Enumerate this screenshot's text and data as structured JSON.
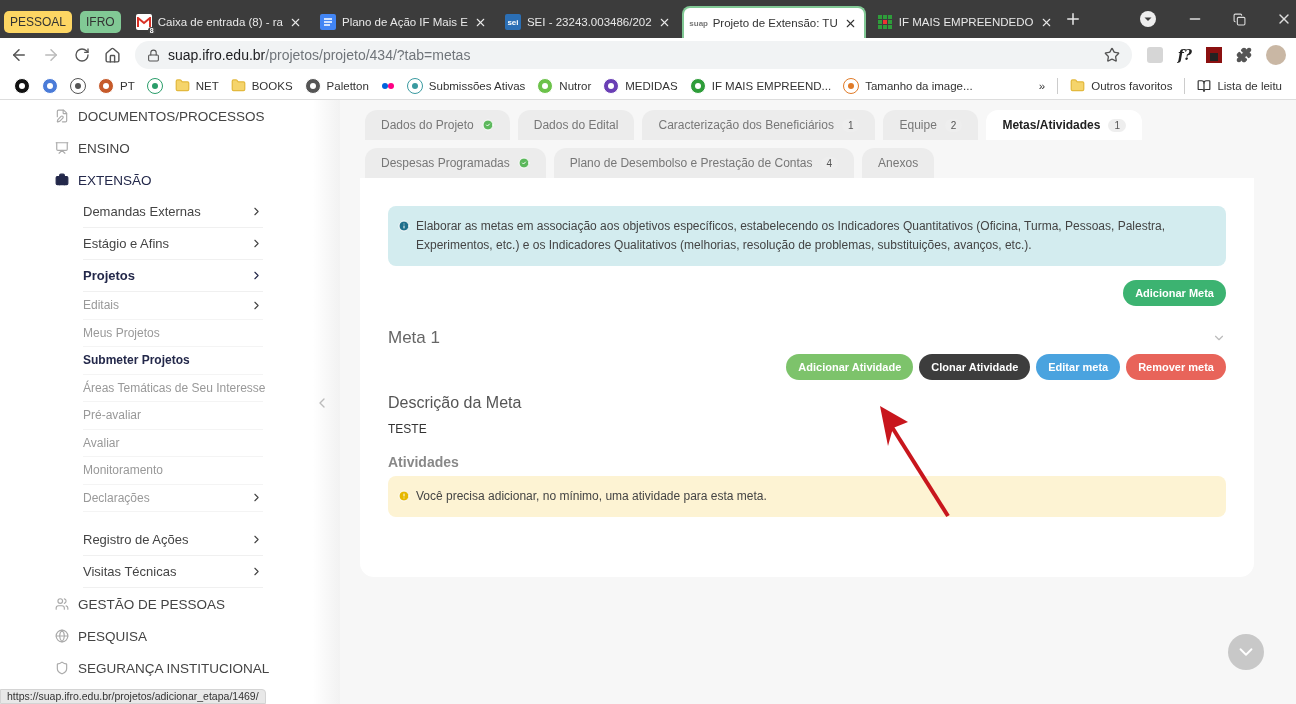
{
  "browser": {
    "groups": [
      {
        "label": "PESSOAL",
        "color": "#fdd663"
      },
      {
        "label": "IFRO",
        "color": "#81c995"
      }
    ],
    "tabs": [
      {
        "kind": "mail",
        "badge": "8",
        "title": "Caixa de entrada (8) - ra",
        "selected": false
      },
      {
        "kind": "doc",
        "title": "Plano de Ação IF Mais E",
        "selected": false
      },
      {
        "kind": "sei",
        "favicon": "sei",
        "title": "SEI - 23243.003486/202",
        "selected": false
      },
      {
        "kind": "suap",
        "favicon": "suap",
        "title": "Projeto de Extensão: TU",
        "selected": true
      },
      {
        "kind": "grid",
        "title": "IF MAIS EMPREENDEDO",
        "selected": false
      }
    ],
    "address": {
      "host": "suap.ifro.edu.br",
      "path": "/projetos/projeto/434/?tab=metas"
    },
    "extension_label": "f?",
    "bookmarks": [
      {
        "kind": "app"
      },
      {
        "kind": "circle"
      },
      {
        "kind": "clock"
      },
      {
        "kind": "ball",
        "label": "PT"
      },
      {
        "kind": "ring"
      },
      {
        "kind": "folder",
        "label": "NET"
      },
      {
        "kind": "folder",
        "label": "BOOKS"
      },
      {
        "kind": "pin",
        "label": "Paletton"
      },
      {
        "kind": "dots"
      },
      {
        "kind": "star",
        "label": "Submissões Ativas"
      },
      {
        "kind": "leaf",
        "label": "Nutror"
      },
      {
        "kind": "list",
        "label": "MEDIDAS"
      },
      {
        "kind": "grid",
        "label": "IF MAIS EMPREEND..."
      },
      {
        "kind": "tt",
        "label": "Tamanho da image..."
      }
    ],
    "bookmarks_overflow": "»",
    "bookmarks_right": [
      {
        "kind": "folder",
        "label": "Outros favoritos"
      },
      {
        "kind": "reading",
        "label": "Lista de leitu"
      }
    ],
    "status_url": "https://suap.ifro.edu.br/projetos/adicionar_etapa/1469/"
  },
  "sidebar": {
    "sections": [
      {
        "label": "DOCUMENTOS/PROCESSOS",
        "expanded": false
      },
      {
        "label": "ENSINO",
        "expanded": false
      },
      {
        "label": "EXTENSÃO",
        "expanded": true,
        "children": [
          {
            "label": "Demandas Externas",
            "submenu": true,
            "expanded": false
          },
          {
            "label": "Estágio e Afins",
            "submenu": true,
            "expanded": false
          },
          {
            "label": "Projetos",
            "submenu": true,
            "expanded": true,
            "children": [
              {
                "label": "Editais",
                "submenu": true,
                "selected": false
              },
              {
                "label": "Meus Projetos",
                "submenu": false,
                "selected": false
              },
              {
                "label": "Submeter Projetos",
                "submenu": false,
                "selected": true
              },
              {
                "label": "Áreas Temáticas de Seu Interesse",
                "submenu": false,
                "selected": false
              },
              {
                "label": "Pré-avaliar",
                "submenu": false,
                "selected": false
              },
              {
                "label": "Avaliar",
                "submenu": false,
                "selected": false
              },
              {
                "label": "Monitoramento",
                "submenu": false,
                "selected": false
              },
              {
                "label": "Declarações",
                "submenu": true,
                "selected": false
              }
            ]
          },
          {
            "label": "Registro de Ações",
            "submenu": true,
            "expanded": false
          },
          {
            "label": "Visitas Técnicas",
            "submenu": true,
            "expanded": false
          }
        ]
      },
      {
        "label": "GESTÃO DE PESSOAS",
        "expanded": false
      },
      {
        "label": "PESQUISA",
        "expanded": false
      },
      {
        "label": "SEGURANÇA INSTITUCIONAL",
        "expanded": false
      }
    ]
  },
  "tabs": [
    [
      {
        "label": "Dados do Projeto",
        "complete": true,
        "selected": false
      },
      {
        "label": "Dados do Edital",
        "complete": false,
        "selected": false
      },
      {
        "label": "Caracterização dos Beneficiários",
        "count": "1",
        "complete": false,
        "selected": false
      },
      {
        "label": "Equipe",
        "count": "2",
        "complete": false,
        "selected": false
      },
      {
        "label": "Metas/Atividades",
        "count": "1",
        "complete": false,
        "selected": true
      }
    ],
    [
      {
        "label": "Despesas Programadas",
        "complete": true,
        "selected": false
      },
      {
        "label": "Plano de Desembolso e Prestação de Contas",
        "count": "4",
        "complete": false,
        "selected": false
      },
      {
        "label": "Anexos",
        "complete": false,
        "selected": false
      }
    ]
  ],
  "info_alert": "Elaborar as metas em associação aos objetivos específicos, estabelecendo os Indicadores Quantitativos (Oficina, Turma, Pessoas, Palestra, Experimentos, etc.) e os Indicadores Qualitativos (melhorias, resolução de problemas, substituições, avanços, etc.).",
  "add_button": {
    "label": "Adicionar Meta",
    "kind": "success"
  },
  "meta": {
    "title": "Meta 1",
    "expanded": true,
    "actions": [
      {
        "label": "Adicionar Atividade",
        "kind": "success-light"
      },
      {
        "label": "Clonar Atividade",
        "kind": "dark"
      },
      {
        "label": "Editar meta",
        "kind": "info"
      },
      {
        "label": "Remover meta",
        "kind": "danger"
      }
    ],
    "description_heading": "Descrição da Meta",
    "description": "TESTE",
    "activities_heading": "Atividades",
    "warning": "Você precisa adicionar, no mínimo, uma atividade para esta meta."
  }
}
